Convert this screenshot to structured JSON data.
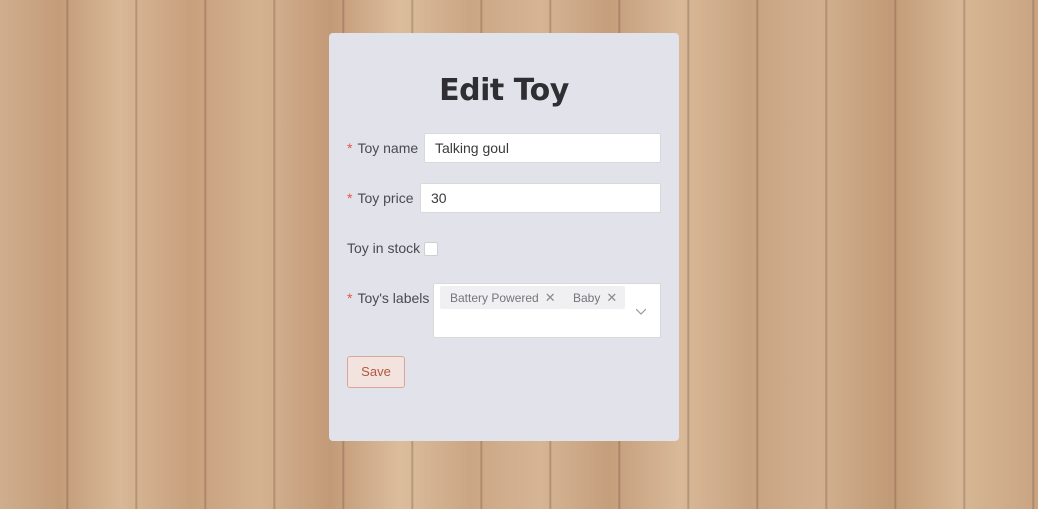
{
  "form": {
    "title": "Edit Toy",
    "name_label": "Toy name",
    "name_value": "Talking goul",
    "price_label": "Toy price",
    "price_value": "30",
    "stock_label": "Toy in stock",
    "stock_checked": false,
    "labels_label": "Toy's labels",
    "labels_tags": [
      "Battery Powered",
      "Baby"
    ],
    "save_label": "Save",
    "required_mark": "*"
  },
  "icons": {
    "tag_remove": "close-icon",
    "dropdown": "chevron-down-icon"
  },
  "colors": {
    "required": "#e2574c",
    "card_bg": "#e2e2ea",
    "save_text": "#b0573f"
  }
}
